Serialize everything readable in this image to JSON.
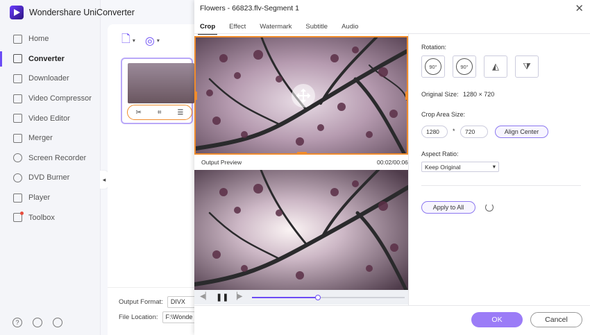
{
  "app": {
    "name": "Wondershare UniConverter",
    "accent": "#6b4cf5"
  },
  "sidebar": {
    "items": [
      {
        "label": "Home",
        "icon": "home-icon"
      },
      {
        "label": "Converter",
        "icon": "converter-icon",
        "active": true
      },
      {
        "label": "Downloader",
        "icon": "download-icon"
      },
      {
        "label": "Video Compressor",
        "icon": "compress-icon"
      },
      {
        "label": "Video Editor",
        "icon": "scissors-icon"
      },
      {
        "label": "Merger",
        "icon": "merge-icon"
      },
      {
        "label": "Screen Recorder",
        "icon": "record-icon"
      },
      {
        "label": "DVD Burner",
        "icon": "disc-icon"
      },
      {
        "label": "Player",
        "icon": "play-icon"
      },
      {
        "label": "Toolbox",
        "icon": "toolbox-icon"
      }
    ],
    "bottom_icons": [
      "help-icon",
      "bell-icon",
      "feedback-icon"
    ]
  },
  "main": {
    "output_format_label": "Output Format:",
    "output_format_value": "DIVX",
    "file_location_label": "File Location:",
    "file_location_value": "F:\\Wonde"
  },
  "dialog": {
    "title": "Flowers - 66823.flv-Segment 1",
    "tabs": [
      "Crop",
      "Effect",
      "Watermark",
      "Subtitle",
      "Audio"
    ],
    "active_tab": "Crop",
    "preview_label": "Output Preview",
    "preview_time": "00:02/00:06",
    "playback_progress": 0.43,
    "rotation_label": "Rotation:",
    "rotation_buttons": [
      {
        "label": "90°",
        "icon": "rotate-clockwise-icon"
      },
      {
        "label": "90°",
        "icon": "rotate-counterclockwise-icon"
      },
      {
        "label": "",
        "icon": "flip-horizontal-icon"
      },
      {
        "label": "",
        "icon": "flip-vertical-icon"
      }
    ],
    "original_size_label": "Original Size:",
    "original_size_value": "1280 × 720",
    "crop_area_label": "Crop Area Size:",
    "crop_width": "1280",
    "crop_sep": "*",
    "crop_height": "720",
    "align_center_label": "Align Center",
    "aspect_ratio_label": "Aspect Ratio:",
    "aspect_ratio_value": "Keep Original",
    "apply_all_label": "Apply to All",
    "ok_label": "OK",
    "cancel_label": "Cancel",
    "close_glyph": "✕"
  }
}
